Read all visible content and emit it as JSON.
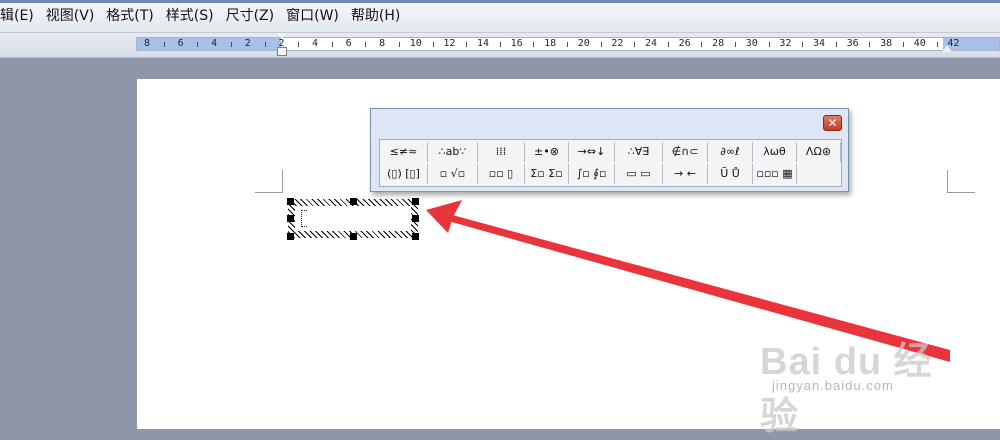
{
  "menubar": {
    "items": [
      {
        "label": "辑(E)"
      },
      {
        "label": "视图(V)"
      },
      {
        "label": "格式(T)"
      },
      {
        "label": "样式(S)"
      },
      {
        "label": "尺寸(Z)"
      },
      {
        "label": "窗口(W)"
      },
      {
        "label": "帮助(H)"
      }
    ]
  },
  "ruler": {
    "labels": [
      "8",
      "6",
      "4",
      "2",
      "2",
      "4",
      "6",
      "8",
      "10",
      "12",
      "14",
      "16",
      "18",
      "20",
      "22",
      "24",
      "26",
      "28",
      "30",
      "32",
      "34",
      "36",
      "38",
      "40",
      "42"
    ]
  },
  "equation_toolbar": {
    "close_label": "✕",
    "row1": [
      "≤≠≈",
      "∴ab∵",
      "⁞⁞⁞",
      "±•⊗",
      "→⇔↓",
      "∴∀∃",
      "∉∩⊂",
      "∂∞ℓ",
      "λωθ",
      "ΛΩ⊛"
    ],
    "row2": [
      "(▯) [▯]",
      "▫ √▫",
      "▫▫ ▯",
      "Σ▫ Σ▫",
      "∫▫ ∮▫",
      "▭ ▭",
      "→ ←",
      "Ū Ů",
      "▫▫▫ ▦"
    ]
  },
  "watermark": {
    "brand": "Bai du 经验",
    "sub": "jingyan.baidu.com"
  },
  "colors": {
    "arrow": "#e8343a",
    "workspace": "#8e97aa",
    "toolbar_bg": "#dde6f4",
    "ruler_shade": "#a9c0e8"
  }
}
